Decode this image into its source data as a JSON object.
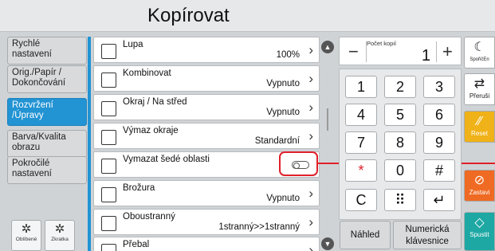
{
  "title": "Kopírovat",
  "sidebar": {
    "tabs": [
      {
        "label": "Rychlé\nnastavení",
        "active": false
      },
      {
        "label": "Orig./Papír /\nDokončování",
        "active": false
      },
      {
        "label": "Rozvržení\n/Úpravy",
        "active": true
      },
      {
        "label": "Barva/Kvalita\nobrazu",
        "active": false
      },
      {
        "label": "Pokročilé\nnastavení",
        "active": false
      }
    ],
    "favorites_label": "Oblíbené",
    "shortcut_label": "Zkratka"
  },
  "list": {
    "rows": [
      {
        "label": "Lupa",
        "value": "100%",
        "icon": "document-icon"
      },
      {
        "label": "Kombinovat",
        "value": "Vypnuto",
        "icon": "combine-icon"
      },
      {
        "label": "Okraj / Na střed",
        "value": "Vypnuto",
        "icon": "margin-icon"
      },
      {
        "label": "Výmaz okraje",
        "value": "Standardní",
        "icon": "border-erase-icon"
      },
      {
        "label": "Vymazat šedé oblasti",
        "value": "",
        "icon": "erase-grey-icon",
        "toggle": false
      },
      {
        "label": "Brožura",
        "value": "Vypnuto",
        "icon": "booklet-icon"
      },
      {
        "label": "Oboustranný",
        "value": "1stranný>>1stranný",
        "icon": "duplex-icon"
      },
      {
        "label": "Přebal",
        "value": "",
        "icon": "cover-icon"
      }
    ]
  },
  "copies": {
    "label": "Počet kopií",
    "value": "1",
    "minus": "−",
    "plus": "+"
  },
  "keypad": {
    "keys": [
      "1",
      "2",
      "3",
      "4",
      "5",
      "6",
      "7",
      "8",
      "9",
      "*",
      "0",
      "#",
      "C",
      "⠿",
      "↵"
    ]
  },
  "bottom": {
    "preview_label": "Náhled",
    "numeric_keypad_label": "Numerická\nklávesnice"
  },
  "right": {
    "sleep_label": "SpořičEn",
    "interrupt_label": "Přeruši",
    "reset_label": "Reset",
    "stop_label": "Zastavi",
    "start_label": "Spustit"
  },
  "colors": {
    "accent": "#2293d3",
    "highlight": "#e0202a",
    "reset": "#f0b219",
    "stop": "#ef6a22",
    "start": "#1ea8a4"
  }
}
